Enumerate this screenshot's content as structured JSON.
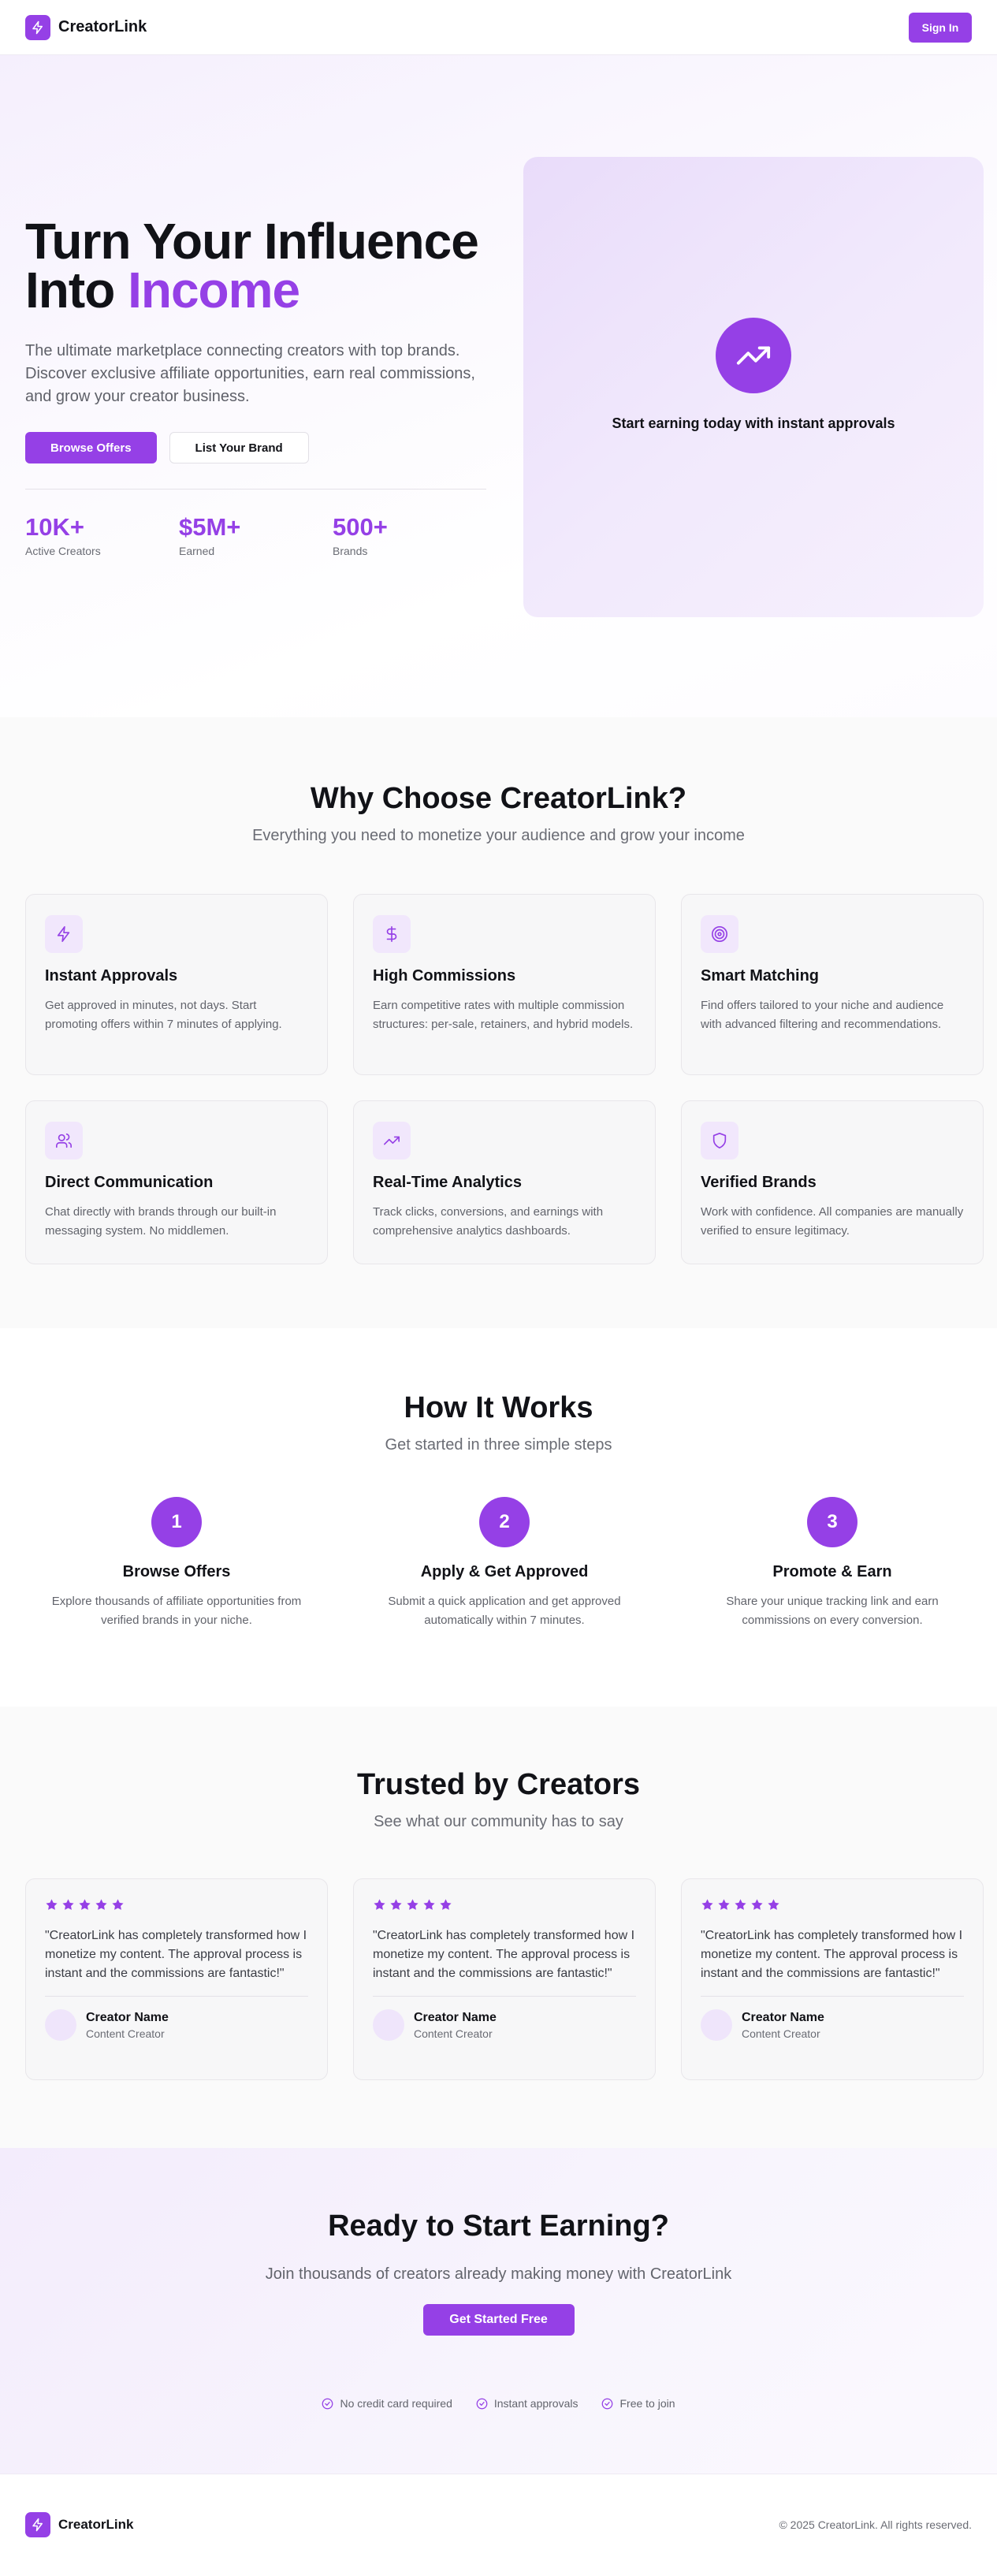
{
  "header": {
    "brand": "CreatorLink",
    "sign_in": "Sign In"
  },
  "hero": {
    "title_line1": "Turn Your Influence",
    "title_line2_prefix": "Into ",
    "title_accent": "Income",
    "description": "The ultimate marketplace connecting creators with top brands. Discover exclusive affiliate opportunities, earn real commissions, and grow your creator business.",
    "primary_button": "Browse Offers",
    "secondary_button": "List Your Brand",
    "stats": [
      {
        "value": "10K+",
        "label": "Active Creators"
      },
      {
        "value": "$5M+",
        "label": "Earned"
      },
      {
        "value": "500+",
        "label": "Brands"
      }
    ],
    "card_text": "Start earning today with instant approvals",
    "card_icon": "trending-up-icon"
  },
  "features": {
    "title": "Why Choose CreatorLink?",
    "subtitle": "Everything you need to monetize your audience and grow your income",
    "items": [
      {
        "icon": "lightning-icon",
        "title": "Instant Approvals",
        "desc": "Get approved in minutes, not days. Start promoting offers within 7 minutes of applying."
      },
      {
        "icon": "dollar-icon",
        "title": "High Commissions",
        "desc": "Earn competitive rates with multiple commission structures: per-sale, retainers, and hybrid models."
      },
      {
        "icon": "target-icon",
        "title": "Smart Matching",
        "desc": "Find offers tailored to your niche and audience with advanced filtering and recommendations."
      },
      {
        "icon": "users-icon",
        "title": "Direct Communication",
        "desc": "Chat directly with brands through our built-in messaging system. No middlemen."
      },
      {
        "icon": "trending-up-icon",
        "title": "Real-Time Analytics",
        "desc": "Track clicks, conversions, and earnings with comprehensive analytics dashboards."
      },
      {
        "icon": "shield-icon",
        "title": "Verified Brands",
        "desc": "Work with confidence. All companies are manually verified to ensure legitimacy."
      }
    ]
  },
  "how": {
    "title": "How It Works",
    "subtitle": "Get started in three simple steps",
    "steps": [
      {
        "num": "1",
        "title": "Browse Offers",
        "desc": "Explore thousands of affiliate opportunities from verified brands in your niche."
      },
      {
        "num": "2",
        "title": "Apply & Get Approved",
        "desc": "Submit a quick application and get approved automatically within 7 minutes."
      },
      {
        "num": "3",
        "title": "Promote & Earn",
        "desc": "Share your unique tracking link and earn commissions on every conversion."
      }
    ]
  },
  "testimonials": {
    "title": "Trusted by Creators",
    "subtitle": "See what our community has to say",
    "rating": 5,
    "items": [
      {
        "quote": "\"CreatorLink has completely transformed how I monetize my content. The approval process is instant and the commissions are fantastic!\"",
        "name": "Creator Name",
        "role": "Content Creator"
      },
      {
        "quote": "\"CreatorLink has completely transformed how I monetize my content. The approval process is instant and the commissions are fantastic!\"",
        "name": "Creator Name",
        "role": "Content Creator"
      },
      {
        "quote": "\"CreatorLink has completely transformed how I monetize my content. The approval process is instant and the commissions are fantastic!\"",
        "name": "Creator Name",
        "role": "Content Creator"
      }
    ]
  },
  "cta": {
    "title": "Ready to Start Earning?",
    "subtitle": "Join thousands of creators already making money with CreatorLink",
    "button": "Get Started Free",
    "checks": [
      "No credit card required",
      "Instant approvals",
      "Free to join"
    ]
  },
  "footer": {
    "brand": "CreatorLink",
    "copyright": "© 2025 CreatorLink. All rights reserved."
  },
  "colors": {
    "accent": "#9540e6",
    "accent_soft": "#f1e7fc"
  }
}
